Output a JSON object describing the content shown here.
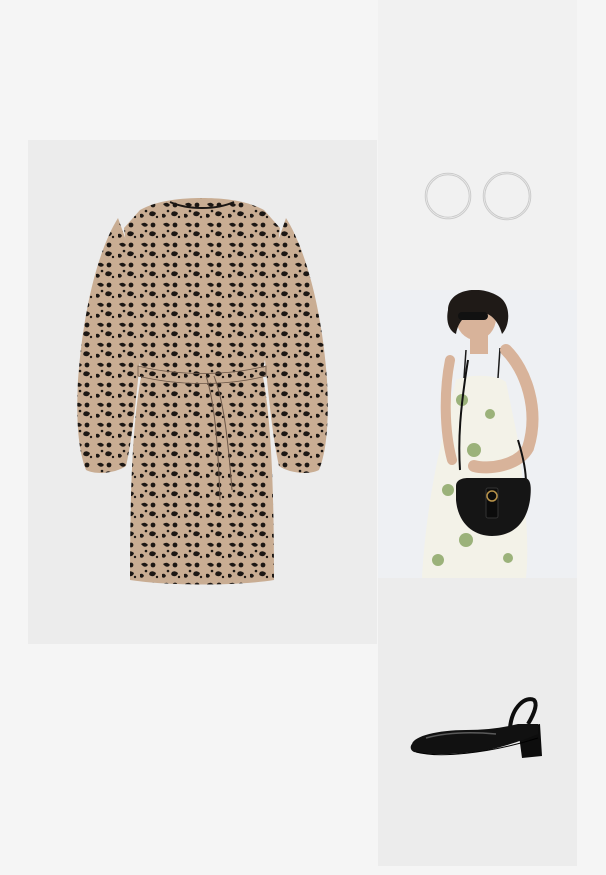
{
  "outfit": {
    "items": [
      {
        "id": "dress",
        "icon": "leopard-print-dress-icon"
      },
      {
        "id": "earrings",
        "icon": "silver-hoop-earrings-icon"
      },
      {
        "id": "bag",
        "icon": "model-with-black-saddle-bag-icon"
      },
      {
        "id": "shoes",
        "icon": "black-patent-slingback-heel-icon"
      }
    ]
  },
  "colors": {
    "page_background": "#f5f5f5",
    "tile_background": "#ececec",
    "dress_base": "#c9ad93",
    "dress_spots": "#1c1714",
    "accent_black": "#111111",
    "silver": "#c8c8c8"
  }
}
